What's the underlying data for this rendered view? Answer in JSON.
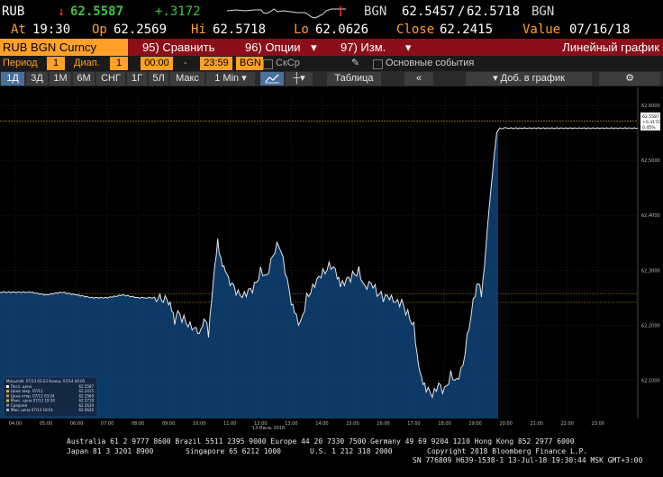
{
  "quote": {
    "ticker": "RUB",
    "arrow": "↓",
    "last": "62.5587",
    "change": "+.3172",
    "currency": "BGN",
    "bid": "62.5457",
    "separator": "/",
    "ask": "62.5718",
    "currency2": "BGN"
  },
  "stats": {
    "at_label": "At",
    "at_value": "19:30",
    "op_label": "Op",
    "op_value": "62.2569",
    "hi_label": "Hi",
    "hi_value": "62.5718",
    "lo_label": "Lo",
    "lo_value": "62.0626",
    "close_label": "Close",
    "close_value": "62.2415",
    "value_label": "Value",
    "value_value": "07/16/18"
  },
  "function_bar": {
    "security": "RUB BGN Curncy",
    "compare_num": "95)",
    "compare_label": "Сравнить",
    "options_num": "96)",
    "options_label": "Опции",
    "edit_num": "97)",
    "edit_label": "Изм.",
    "chart_type": "Линейный график",
    "dropdown_glyph": "▾"
  },
  "params": {
    "period_label": "Период",
    "period_value": "1",
    "range_label": "Диап.",
    "range_value": "1",
    "time_from": "00:00",
    "dash": "-",
    "time_to": "23:59",
    "source": "BGN",
    "bidask_label": "СкСр",
    "events_label": "Основные события"
  },
  "toolbar": {
    "ranges": [
      "1Д",
      "3Д",
      "1М",
      "6М",
      "СНГ",
      "1Г",
      "5Л",
      "Макс"
    ],
    "interval": "1 Min",
    "table_label": "Таблица",
    "add_label": "Доб. в график"
  },
  "chart_data": {
    "type": "line",
    "x_tick_labels": [
      "04:00",
      "05:00",
      "06:00",
      "07:00",
      "08:00",
      "09:00",
      "10:00",
      "11:00",
      "12:00",
      "13:00",
      "14:00",
      "15:00",
      "16:00",
      "17:00",
      "18:00",
      "19:00",
      "20:00",
      "21:00",
      "22:00",
      "23:00"
    ],
    "date_label": "13 Июль 2018",
    "y_tick_labels": [
      "62,6000",
      "62,5000",
      "62,4000",
      "62,3000",
      "62,2000",
      "62,1000"
    ],
    "ylim": [
      62.03,
      62.62
    ],
    "xlim": [
      3.5,
      24.3
    ],
    "last_value_box": [
      "62.5587",
      "+0.3172",
      "0.45%"
    ],
    "reference_lines": {
      "high": 62.5718,
      "low": 62.0626,
      "open": 62.2569,
      "close": 62.2415
    },
    "x": [
      3.5,
      4.5,
      5.0,
      5.5,
      6.0,
      6.5,
      7.0,
      7.5,
      8.0,
      8.3,
      8.6,
      9.0,
      9.1,
      9.2,
      9.3,
      9.5,
      9.7,
      9.9,
      10.0,
      10.1,
      10.2,
      10.3,
      10.4,
      10.5,
      10.6,
      10.7,
      10.8,
      10.9,
      11.0,
      11.2,
      11.4,
      11.6,
      11.8,
      12.0,
      12.2,
      12.4,
      12.6,
      12.8,
      13.0,
      13.1,
      13.3,
      13.5,
      13.7,
      13.9,
      14.1,
      14.3,
      14.5,
      14.6,
      14.8,
      15.0,
      15.2,
      15.4,
      15.6,
      15.8,
      16.0,
      16.2,
      16.4,
      16.6,
      16.8,
      17.0,
      17.1,
      17.2,
      17.3,
      17.4,
      17.6,
      17.8,
      18.0,
      18.2,
      18.4,
      18.6,
      18.8,
      19.0,
      19.1,
      19.2,
      19.3,
      19.4,
      19.5,
      19.6,
      19.7,
      19.8,
      19.9,
      20.0,
      20.5,
      21.0,
      21.5,
      22.0,
      22.5,
      23.0,
      23.5,
      24.0,
      24.3
    ],
    "values": [
      62.26,
      62.26,
      62.255,
      62.26,
      62.255,
      62.25,
      62.25,
      62.255,
      62.25,
      62.25,
      62.25,
      62.245,
      62.23,
      62.2,
      62.22,
      62.21,
      62.2,
      62.195,
      62.19,
      62.205,
      62.215,
      62.18,
      62.24,
      62.3,
      62.35,
      62.32,
      62.31,
      62.3,
      62.28,
      62.26,
      62.25,
      62.26,
      62.27,
      62.3,
      62.29,
      62.33,
      62.35,
      62.3,
      62.24,
      62.22,
      62.2,
      62.25,
      62.27,
      62.29,
      62.3,
      62.31,
      62.29,
      62.27,
      62.28,
      62.29,
      62.3,
      62.27,
      62.28,
      62.26,
      62.25,
      62.25,
      62.24,
      62.24,
      62.22,
      62.2,
      62.15,
      62.12,
      62.1,
      62.085,
      62.07,
      62.09,
      62.08,
      62.11,
      62.1,
      62.13,
      62.2,
      62.26,
      62.28,
      62.25,
      62.3,
      62.38,
      62.44,
      62.5,
      62.55,
      62.5587,
      62.5587,
      62.5587,
      62.5587,
      62.5587,
      62.5587,
      62.5587,
      62.5587,
      62.5587,
      62.5587,
      62.5587,
      62.5587
    ]
  },
  "legend": {
    "header": "Масштаб: 07/13 03:23 Конец: 07/14 04:05",
    "rows": [
      {
        "label": "Посл. цена",
        "value": "62.5587"
      },
      {
        "label": "Цена закр. 07/12",
        "value": "62.2415"
      },
      {
        "label": "Цена откр. 07/13 03:24",
        "value": "62.2569"
      },
      {
        "label": "Макс. цена 07/13 19:30",
        "value": "62.5718"
      },
      {
        "label": "Средняя",
        "value": "62.2639"
      },
      {
        "label": "Мин. цена 07/13 18:01",
        "value": "62.0626"
      }
    ]
  },
  "footer": {
    "line1": "Australia 61 2 9777 8600 Brazil 5511 2395 9000 Europe 44 20 7330 7500 Germany 49 69 9204 1210 Hong Kong 852 2977 6000",
    "line2a": "Japan 81 3 3201 8900",
    "line2b": "Singapore 65 6212 1000",
    "line2c": "U.S. 1 212 318 2000",
    "line2d": "Copyright 2018 Bloomberg Finance L.P.",
    "line3": "SN 776809 H639-1538-1 13-Jul-18 19:30:44 MSK  GMT+3:00"
  },
  "colors": {
    "orange": "#ffa028",
    "function_bar": "#8b0e1a",
    "up_green": "#3ec43e",
    "down_red": "#ff3030",
    "area_fill": "#0e3c6b"
  }
}
